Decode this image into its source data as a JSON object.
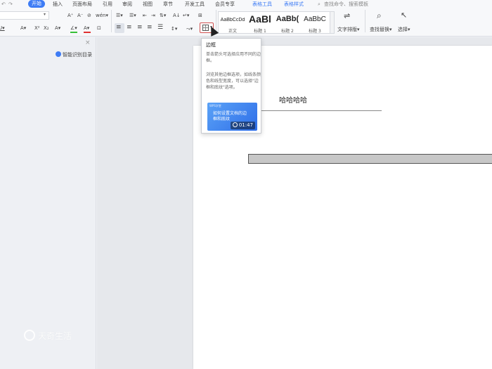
{
  "menu": {
    "tabs": [
      "开始",
      "插入",
      "页面布局",
      "引用",
      "审阅",
      "视图",
      "章节",
      "开发工具",
      "会员专享",
      "表格工具",
      "表格样式"
    ],
    "active_tab": "开始",
    "search_placeholder": "查找命令、搜索模板"
  },
  "ribbon": {
    "quick_left": [
      "↶",
      "↷"
    ],
    "font_size_arrow": "▾",
    "row1_font_tools": [
      "A⁺",
      "A⁻",
      "⊘",
      "wén▾"
    ],
    "row1_para_tools": [
      "☰▾",
      "☰▾",
      "⇤",
      "⇥",
      "⇅▾",
      "A↓",
      "↵▾",
      "⊞"
    ],
    "row2_font_tools": [
      "U▾",
      "A▾",
      "X²",
      "X₂",
      "A▾",
      "∠▾",
      "A▾",
      "⊡"
    ],
    "row2_align_tools": [
      "≡",
      "≡",
      "≡",
      "≡",
      "☰",
      "↕▾",
      "⤳▾"
    ],
    "styles": [
      {
        "preview": "AaBbCcDd",
        "name": "正文",
        "size": 7
      },
      {
        "preview": "AaBl",
        "name": "标题 1",
        "size": 14
      },
      {
        "preview": "AaBb(",
        "name": "标题 2",
        "size": 12
      },
      {
        "preview": "AaBbC",
        "name": "标题 3",
        "size": 11
      }
    ],
    "text_layout_label": "文字排版▾",
    "find_replace_label": "查找替换▾",
    "select_label": "选择▾"
  },
  "nav_pane": {
    "close": "×",
    "smart_toc": "智能识别目录"
  },
  "document": {
    "text": "哈哈哈哈"
  },
  "tooltip": {
    "title": "边框",
    "desc": "单击箭头可选择应用不同的边框。",
    "desc2": "浏览其他边框选项，如线条颜色和线型宽度，可以选择\"边框和底纹\"选项。",
    "video_brand": "WPS学堂",
    "video_title": "如何设置文档的边框和底纹",
    "duration": "01:47"
  },
  "watermark": "天奇生活",
  "colors": {
    "accent": "#3e7cf5",
    "highlight_green": "#37c037",
    "font_red": "#e03030",
    "font_blue": "#2a5bd7"
  }
}
